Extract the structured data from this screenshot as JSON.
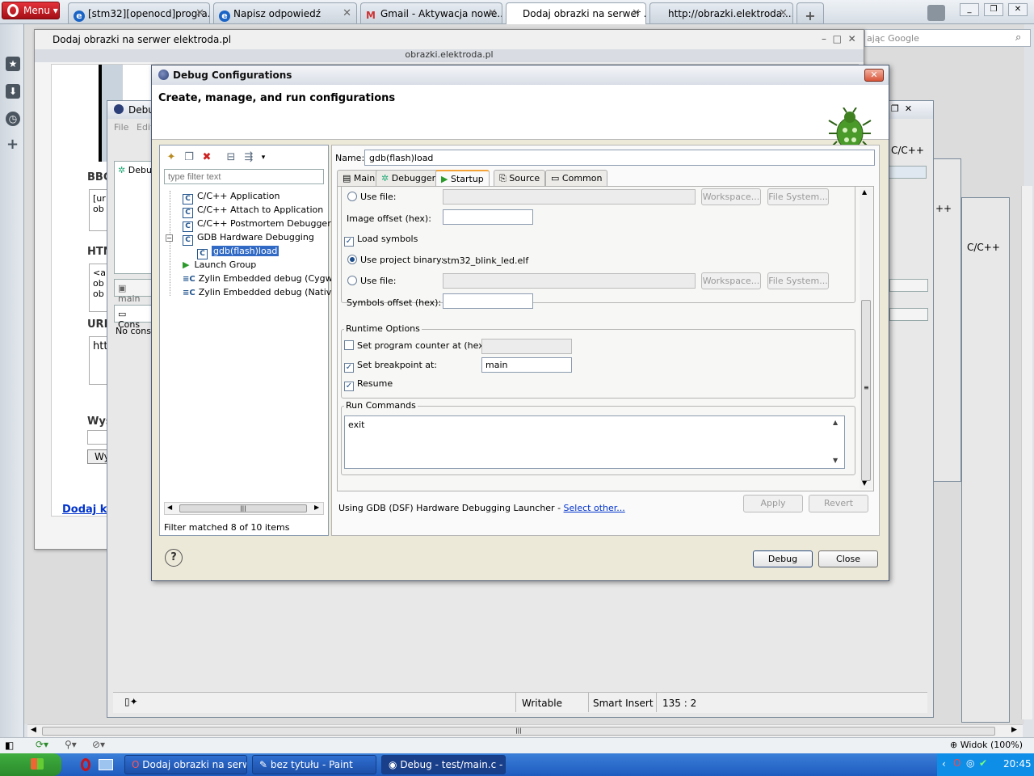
{
  "browser": {
    "menu_label": "Menu",
    "tabs": [
      {
        "label": "[stm32][openocd]progra...",
        "icon": "ie-icon"
      },
      {
        "label": "Napisz odpowiedź",
        "icon": "ie-icon"
      },
      {
        "label": "Gmail - Aktywacja nowe...",
        "icon": "gmail-icon"
      },
      {
        "label": "Dodaj obrazki na serwer ...",
        "icon": "none"
      },
      {
        "label": "http://obrazki.elektroda....",
        "icon": "none"
      }
    ],
    "search_placeholder": "ając Google",
    "zoom_label": "Widok (100%)"
  },
  "popup": {
    "title": "Dodaj obrazki na serwer elektroda.pl",
    "url": "obrazki.elektroda.pl",
    "partial_labels": {
      "bbc": "BBC",
      "htm": "HTM",
      "url": "URL",
      "wys": "Wys",
      "dodaj": "Dodaj ko",
      "ur": "[ur",
      "ob": "ob",
      "a": "<a",
      "htt": "htt",
      "wy": "Wy"
    }
  },
  "eclipse_bg": {
    "title": "Debu",
    "menu_file": "File",
    "menu_edit": "Edit",
    "debug_tab": "Debu",
    "main_tab": "main",
    "cons_tab": "Cons",
    "no_console": "No conso",
    "perspective": "C/C++",
    "perspective2": "C/C++",
    "status": {
      "writable": "Writable",
      "insert": "Smart Insert",
      "position": "135 : 2"
    }
  },
  "dialog": {
    "title": "Debug Configurations",
    "heading": "Create, manage, and run configurations",
    "filter_placeholder": "type filter text",
    "tree": [
      {
        "label": "C/C++ Application",
        "icon": "C",
        "indent": 1
      },
      {
        "label": "C/C++ Attach to Application",
        "icon": "C",
        "indent": 1
      },
      {
        "label": "C/C++ Postmortem Debugger",
        "icon": "C",
        "indent": 1
      },
      {
        "label": "GDB Hardware Debugging",
        "icon": "C",
        "indent": 1
      },
      {
        "label": "gdb(flash)load",
        "icon": "C",
        "indent": 2,
        "selected": true
      },
      {
        "label": "Launch Group",
        "icon": "launch-group-icon",
        "indent": 1
      },
      {
        "label": "Zylin Embedded debug (Cygwin)",
        "icon": "zylin-icon",
        "indent": 1
      },
      {
        "label": "Zylin Embedded debug (Native)",
        "icon": "zylin-icon",
        "indent": 1
      }
    ],
    "filter_status": "Filter matched 8 of 10 items",
    "name_label": "Name:",
    "name_value": "gdb(flash)load",
    "config_tabs": [
      "Main",
      "Debugger",
      "Startup",
      "Source",
      "Common"
    ],
    "active_tab": "Startup",
    "startup": {
      "use_file_1": "Use file:",
      "workspace_1": "Workspace...",
      "filesystem_1": "File System...",
      "image_offset": "Image offset (hex):",
      "load_symbols": "Load symbols",
      "use_project_binary": "Use project binary:",
      "project_binary": "stm32_blink_led.elf",
      "use_file_2": "Use file:",
      "workspace_2": "Workspace...",
      "filesystem_2": "File System...",
      "symbols_offset": "Symbols offset (hex):",
      "runtime_options": "Runtime Options",
      "set_pc": "Set program counter at (hex):",
      "set_breakpoint": "Set breakpoint at:",
      "breakpoint_value": "main",
      "resume": "Resume",
      "run_commands": "Run Commands",
      "run_commands_value": "exit"
    },
    "launcher_text": "Using GDB (DSF) Hardware Debugging Launcher - ",
    "select_other": "Select other...",
    "apply": "Apply",
    "revert": "Revert",
    "debug": "Debug",
    "close": "Close"
  },
  "taskbar": {
    "items": [
      "Dodaj obrazki na serw...",
      "bez tytułu - Paint",
      "Debug - test/main.c - ..."
    ],
    "clock": "20:45"
  },
  "colors": {
    "selection": "#316ac5",
    "taskbar": "#1f5bbf",
    "opera_red": "#c8141c"
  }
}
